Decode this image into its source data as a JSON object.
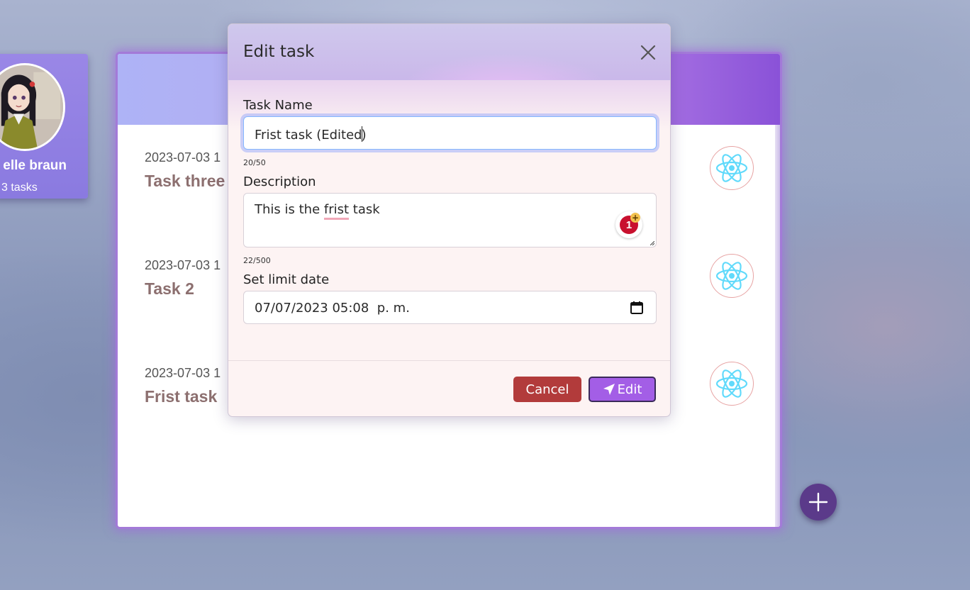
{
  "profile": {
    "name": "elle braun",
    "task_count": "3 tasks"
  },
  "tasks": [
    {
      "date": "2023-07-03 1",
      "title": "Task three"
    },
    {
      "date": "2023-07-03 1",
      "title": "Task 2"
    },
    {
      "date": "2023-07-03 1",
      "title": "Frist task"
    }
  ],
  "modal": {
    "title": "Edit task",
    "task_name_label": "Task Name",
    "task_name_before": "Frist task (Edited",
    "task_name_after": ")",
    "task_name_counter": "20/50",
    "description_label": "Description",
    "description_pre": "This is the ",
    "description_flag": "frist",
    "description_post": " task",
    "description_counter": "22/500",
    "grammar_issues": "1",
    "grammar_plus": "+",
    "limit_date_label": "Set limit date",
    "limit_date_value": "07/07/2023 05:08  p. m.",
    "cancel_label": "Cancel",
    "edit_label": "Edit"
  },
  "colors": {
    "accent": "#a35ee6",
    "cancel": "#b23b3b",
    "fab": "#5b3a8a",
    "task_title": "#8c6f6f"
  },
  "icons": {
    "close": "close-icon",
    "react": "react-logo-icon",
    "calendar": "calendar-icon",
    "send": "send-icon",
    "plus": "plus-icon"
  }
}
